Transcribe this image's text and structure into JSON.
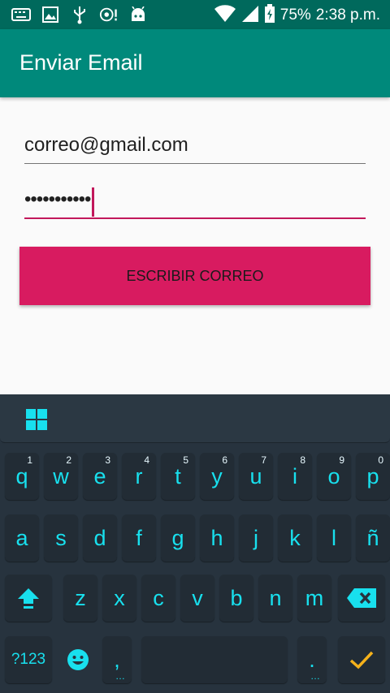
{
  "status_bar": {
    "battery": "75%",
    "time": "2:38 p.m.",
    "left_icons": [
      "keyboard-icon",
      "image-icon",
      "usb-icon",
      "vpn-icon",
      "android-icon"
    ],
    "right_icons": [
      "wifi-icon",
      "signal-icon",
      "battery-icon"
    ]
  },
  "app_bar": {
    "title": "Enviar Email"
  },
  "form": {
    "email_value": "correo@gmail.com",
    "password_value": "•••••••••••",
    "button_label": "ESCRIBIR CORREO"
  },
  "keyboard": {
    "row1": [
      {
        "key": "q",
        "hint": "1"
      },
      {
        "key": "w",
        "hint": "2"
      },
      {
        "key": "e",
        "hint": "3"
      },
      {
        "key": "r",
        "hint": "4"
      },
      {
        "key": "t",
        "hint": "5"
      },
      {
        "key": "y",
        "hint": "6"
      },
      {
        "key": "u",
        "hint": "7"
      },
      {
        "key": "i",
        "hint": "8"
      },
      {
        "key": "o",
        "hint": "9"
      },
      {
        "key": "p",
        "hint": "0"
      }
    ],
    "row2": [
      "a",
      "s",
      "d",
      "f",
      "g",
      "h",
      "j",
      "k",
      "l",
      "ñ"
    ],
    "row3": [
      "z",
      "x",
      "c",
      "v",
      "b",
      "n",
      "m"
    ],
    "symbols_label": "?123",
    "comma_label": ",",
    "period_label": ".",
    "more_dots": "…"
  },
  "colors": {
    "primary_dark": "#00695c",
    "primary": "#00897b",
    "accent": "#d81b60",
    "keyboard_bg": "#27333e",
    "key_text": "#18e0ee",
    "enter_check": "#f5b21b"
  }
}
